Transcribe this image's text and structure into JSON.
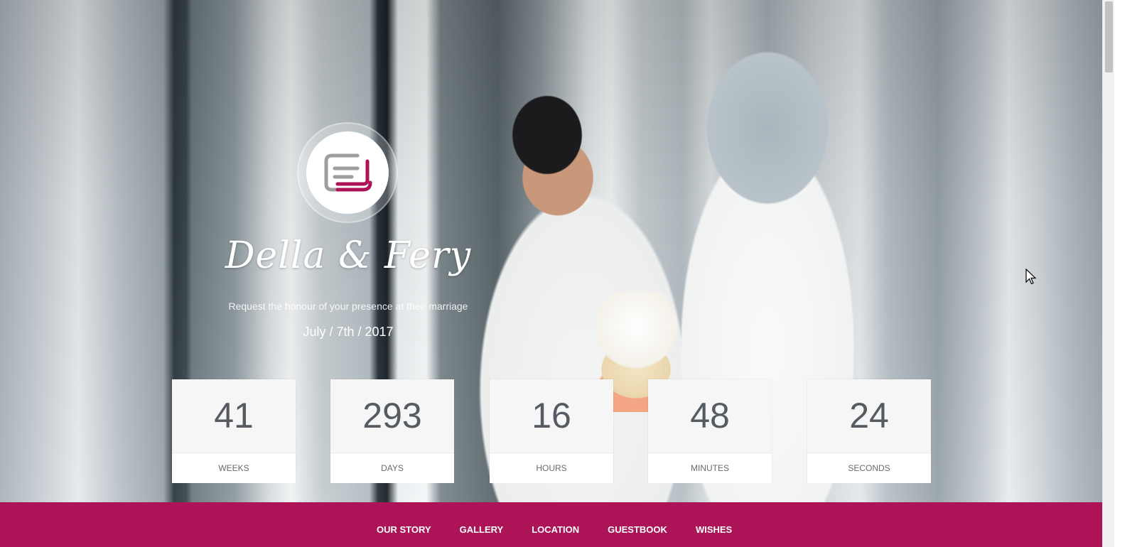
{
  "hero": {
    "couple_name": "Della & Fery",
    "subtitle": "Request the honour of your presence at their marriage",
    "date": "July / 7th / 2017"
  },
  "logo": {
    "icon": "monogram-logo-icon",
    "colors": {
      "gray": "#9e9e9e",
      "accent": "#ad1457"
    }
  },
  "countdown": [
    {
      "value": "41",
      "label": "WEEKS"
    },
    {
      "value": "293",
      "label": "DAYS"
    },
    {
      "value": "16",
      "label": "HOURS"
    },
    {
      "value": "48",
      "label": "MINUTES"
    },
    {
      "value": "24",
      "label": "SECONDS"
    }
  ],
  "nav": {
    "items": [
      "OUR STORY",
      "GALLERY",
      "LOCATION",
      "GUESTBOOK",
      "WISHES"
    ],
    "background": "#ad1457"
  }
}
